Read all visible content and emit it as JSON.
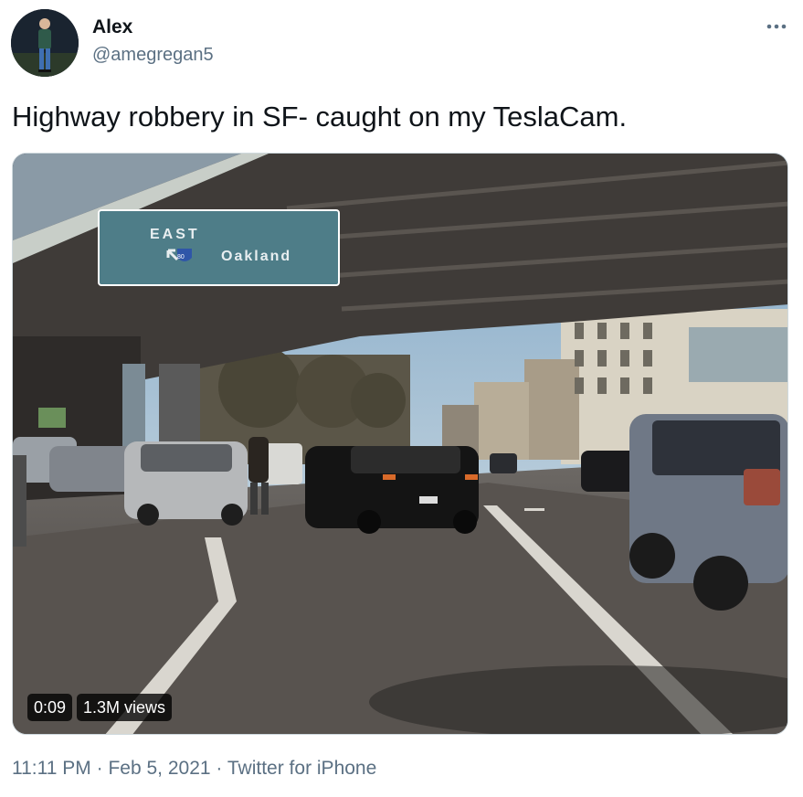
{
  "author": {
    "name": "Alex",
    "handle": "@amegregan5",
    "avatar_icon": "person-standing-icon"
  },
  "more_icon": "more-dots-icon",
  "tweet": {
    "text": "Highway robbery in SF- caught on my TeslaCam."
  },
  "media": {
    "sign": {
      "direction": "EAST",
      "route": "80",
      "destination": "Oakland"
    },
    "duration": "0:09",
    "views": "1.3M views"
  },
  "meta": {
    "time": "11:11 PM",
    "sep1": "·",
    "date": "Feb 5, 2021",
    "sep2": "·",
    "source": "Twitter for iPhone"
  },
  "colors": {
    "secondary_text": "#5b7083",
    "primary_text": "#0f1419",
    "sign_green": "#4e7d88"
  }
}
